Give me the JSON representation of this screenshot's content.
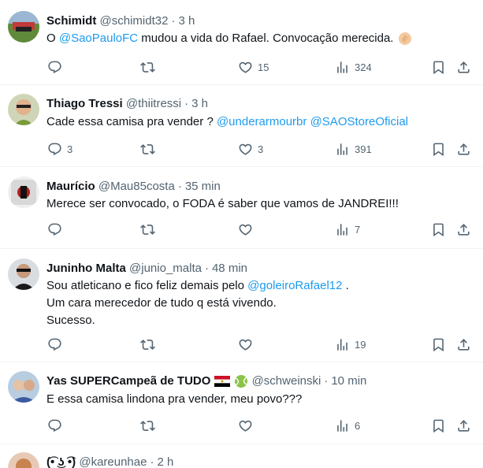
{
  "tweets": [
    {
      "name": "Schimidt",
      "handle": "@schimidt32",
      "time": "3 h",
      "parts": [
        {
          "t": "O "
        },
        {
          "t": "@SaoPauloFC",
          "m": true
        },
        {
          "t": " mudou a vida do Rafael. Convocação merecida. "
        }
      ],
      "emoji": "clapping-hands",
      "replies": "",
      "retweets": "",
      "likes": "15",
      "views": "324"
    },
    {
      "name": "Thiago Tressi",
      "handle": "@thiitressi",
      "time": "3 h",
      "parts": [
        {
          "t": "Cade essa camisa pra vender ? "
        },
        {
          "t": "@underarmourbr",
          "m": true
        },
        {
          "t": " "
        },
        {
          "t": "@SAOStoreOficial",
          "m": true
        }
      ],
      "replies": "3",
      "retweets": "",
      "likes": "3",
      "views": "391"
    },
    {
      "name": "Maurício",
      "handle": "@Mau85costa",
      "time": "35 min",
      "parts": [
        {
          "t": "Merece ser convocado, o FODA é saber que vamos de JANDREI!!!"
        }
      ],
      "replies": "",
      "retweets": "",
      "likes": "",
      "views": "7"
    },
    {
      "name": "Juninho Malta",
      "handle": "@junio_malta",
      "time": "48 min",
      "lines": [
        [
          {
            "t": "Sou atleticano e fico feliz demais pelo "
          },
          {
            "t": "@goleiroRafael12",
            "m": true
          },
          {
            "t": " ."
          }
        ],
        [
          {
            "t": "Um cara merecedor de tudo q está vivendo."
          }
        ],
        [
          {
            "t": "Sucesso."
          }
        ]
      ],
      "replies": "",
      "retweets": "",
      "likes": "",
      "views": "19"
    },
    {
      "name": "Yas SUPERCampeã de TUDO",
      "handle": "@schweinski",
      "time": "10 min",
      "name_emojis": [
        "egypt-flag",
        "tennis-ball"
      ],
      "parts": [
        {
          "t": "E essa camisa lindona pra vender, meu povo???"
        }
      ],
      "replies": "",
      "retweets": "",
      "likes": "",
      "views": "6"
    },
    {
      "name": "(͡• ͜ʖ ͡•)",
      "handle": "@kareunhae",
      "time": "2 h",
      "parts": []
    }
  ],
  "separator": "·",
  "colors": {
    "text": "#0f1419",
    "meta": "#536471",
    "mention": "#1d9bf0",
    "border": "#eff3f4"
  },
  "icons": [
    "reply-icon",
    "retweet-icon",
    "like-icon",
    "views-icon",
    "bookmark-icon",
    "share-icon"
  ]
}
